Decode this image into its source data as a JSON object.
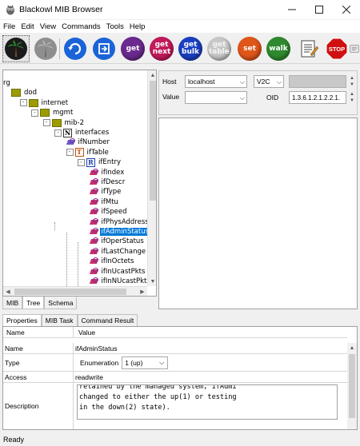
{
  "window": {
    "title": "Blackowl MIB Browser"
  },
  "menu": [
    "File",
    "Edit",
    "View",
    "Commands",
    "Tools",
    "Help"
  ],
  "toolbar": {
    "buttons": [
      {
        "name": "palm-tree",
        "label": "",
        "color": "#1b1b1b"
      },
      {
        "name": "grey-tree",
        "label": "",
        "color": "#9a9a9a"
      },
      {
        "name": "refresh-blue",
        "label": "",
        "color": "#1a63d8"
      },
      {
        "name": "refresh-blue-2",
        "label": "",
        "color": "#1a63d8"
      },
      {
        "name": "get",
        "label": "get",
        "color": "#6b2a8f"
      },
      {
        "name": "get-next",
        "label": "get next",
        "color": "#c21a5a"
      },
      {
        "name": "get-bulk",
        "label": "get bulk",
        "color": "#1a40c2"
      },
      {
        "name": "get-table",
        "label": "get table",
        "color": "#c8c8c8"
      },
      {
        "name": "set",
        "label": "set",
        "color": "#e0561a"
      },
      {
        "name": "walk",
        "label": "walk",
        "color": "#2f8a2f"
      },
      {
        "name": "notes",
        "label": "",
        "color": "#e8e8e8"
      },
      {
        "name": "stop",
        "label": "STOP",
        "color": "#d01010"
      },
      {
        "name": "settings",
        "label": "",
        "color": "#e8e8e8"
      }
    ]
  },
  "tree": {
    "nodes": [
      {
        "label": "rg",
        "level": 0,
        "icon": "none"
      },
      {
        "label": "dod",
        "level": 0,
        "icon": "folder"
      },
      {
        "label": "internet",
        "level": 1,
        "icon": "folder",
        "toggle": "-"
      },
      {
        "label": "mgmt",
        "level": 2,
        "icon": "folder",
        "toggle": "-"
      },
      {
        "label": "mib-2",
        "level": 3,
        "icon": "folder",
        "toggle": "-"
      },
      {
        "label": "interfaces",
        "level": 4,
        "icon": "N",
        "toggle": "-"
      },
      {
        "label": "ifNumber",
        "level": 5,
        "icon": "leaf-blue"
      },
      {
        "label": "ifTable",
        "level": 5,
        "icon": "T",
        "toggle": "-"
      },
      {
        "label": "ifEntry",
        "level": 6,
        "icon": "R",
        "toggle": "-"
      },
      {
        "label": "ifIndex",
        "level": 7,
        "icon": "leaf"
      },
      {
        "label": "ifDescr",
        "level": 7,
        "icon": "leaf"
      },
      {
        "label": "ifType",
        "level": 7,
        "icon": "leaf"
      },
      {
        "label": "ifMtu",
        "level": 7,
        "icon": "leaf"
      },
      {
        "label": "ifSpeed",
        "level": 7,
        "icon": "leaf"
      },
      {
        "label": "ifPhysAddress",
        "level": 7,
        "icon": "leaf"
      },
      {
        "label": "ifAdminStatus",
        "level": 7,
        "icon": "leaf",
        "selected": true
      },
      {
        "label": "ifOperStatus",
        "level": 7,
        "icon": "leaf"
      },
      {
        "label": "ifLastChange",
        "level": 7,
        "icon": "leaf"
      },
      {
        "label": "ifInOctets",
        "level": 7,
        "icon": "leaf"
      },
      {
        "label": "ifInUcastPkts",
        "level": 7,
        "icon": "leaf"
      },
      {
        "label": "ifInNUcastPkts",
        "level": 7,
        "icon": "leaf"
      }
    ]
  },
  "left_tabs": [
    "MIB",
    "Tree",
    "Schema"
  ],
  "form": {
    "host_label": "Host",
    "host_value": "localhost",
    "version_value": "V2C",
    "value_label": "Value",
    "value_value": "",
    "oid_label": "OID",
    "oid_value": "1.3.6.1.2.1.2.2.1."
  },
  "bottom_tabs": [
    "Properties",
    "MIB Task",
    "Command Result"
  ],
  "properties": {
    "header_name": "Name",
    "header_value": "Value",
    "rows": {
      "name_label": "Name",
      "name_value": "ifAdminStatus",
      "type_label": "Type",
      "type_prefix": "Enumeration",
      "type_value": "1 (up)",
      "access_label": "Access",
      "access_value": "readwrite",
      "description_label": "Description",
      "description_lines": [
        "retained by the managed system, ifAdmi",
        "changed to either the up(1) or testing",
        "in the down(2) state)."
      ]
    }
  },
  "status": "Ready"
}
